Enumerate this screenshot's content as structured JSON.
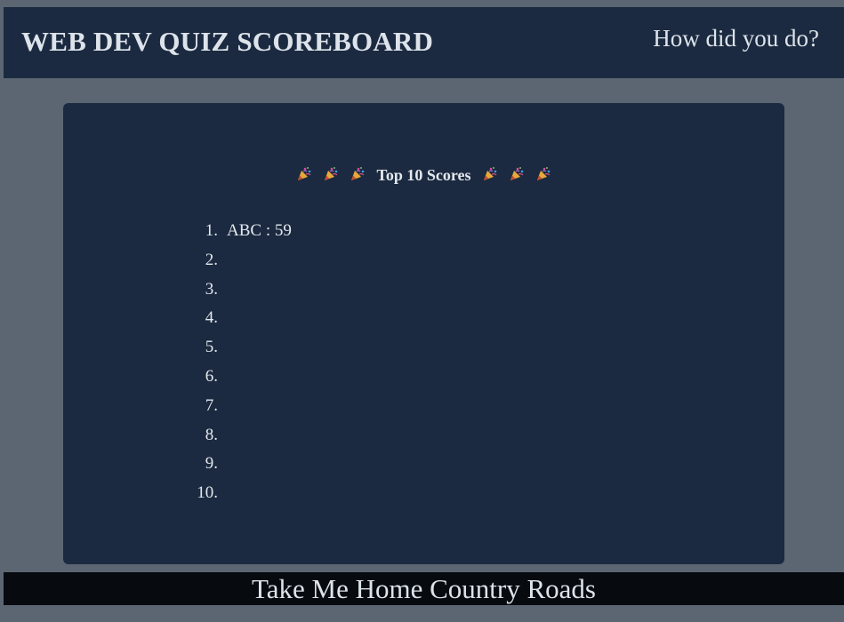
{
  "header": {
    "title": "WEB DEV QUIZ SCOREBOARD",
    "tagline": "How did you do?"
  },
  "scoreboard": {
    "heading": "Top 10 Scores",
    "icon": "party-popper-icon",
    "scores": [
      {
        "rank": "1.",
        "entry": "ABC : 59"
      },
      {
        "rank": "2.",
        "entry": ""
      },
      {
        "rank": "3.",
        "entry": ""
      },
      {
        "rank": "4.",
        "entry": ""
      },
      {
        "rank": "5.",
        "entry": ""
      },
      {
        "rank": "6.",
        "entry": ""
      },
      {
        "rank": "7.",
        "entry": ""
      },
      {
        "rank": "8.",
        "entry": ""
      },
      {
        "rank": "9.",
        "entry": ""
      },
      {
        "rank": "10.",
        "entry": ""
      }
    ]
  },
  "footer": {
    "link_label": "Take Me Home Country Roads"
  },
  "colors": {
    "page_background": "#5b6672",
    "panel": "#1b2a40",
    "footer": "#070b10",
    "text": "#dde3ea"
  }
}
